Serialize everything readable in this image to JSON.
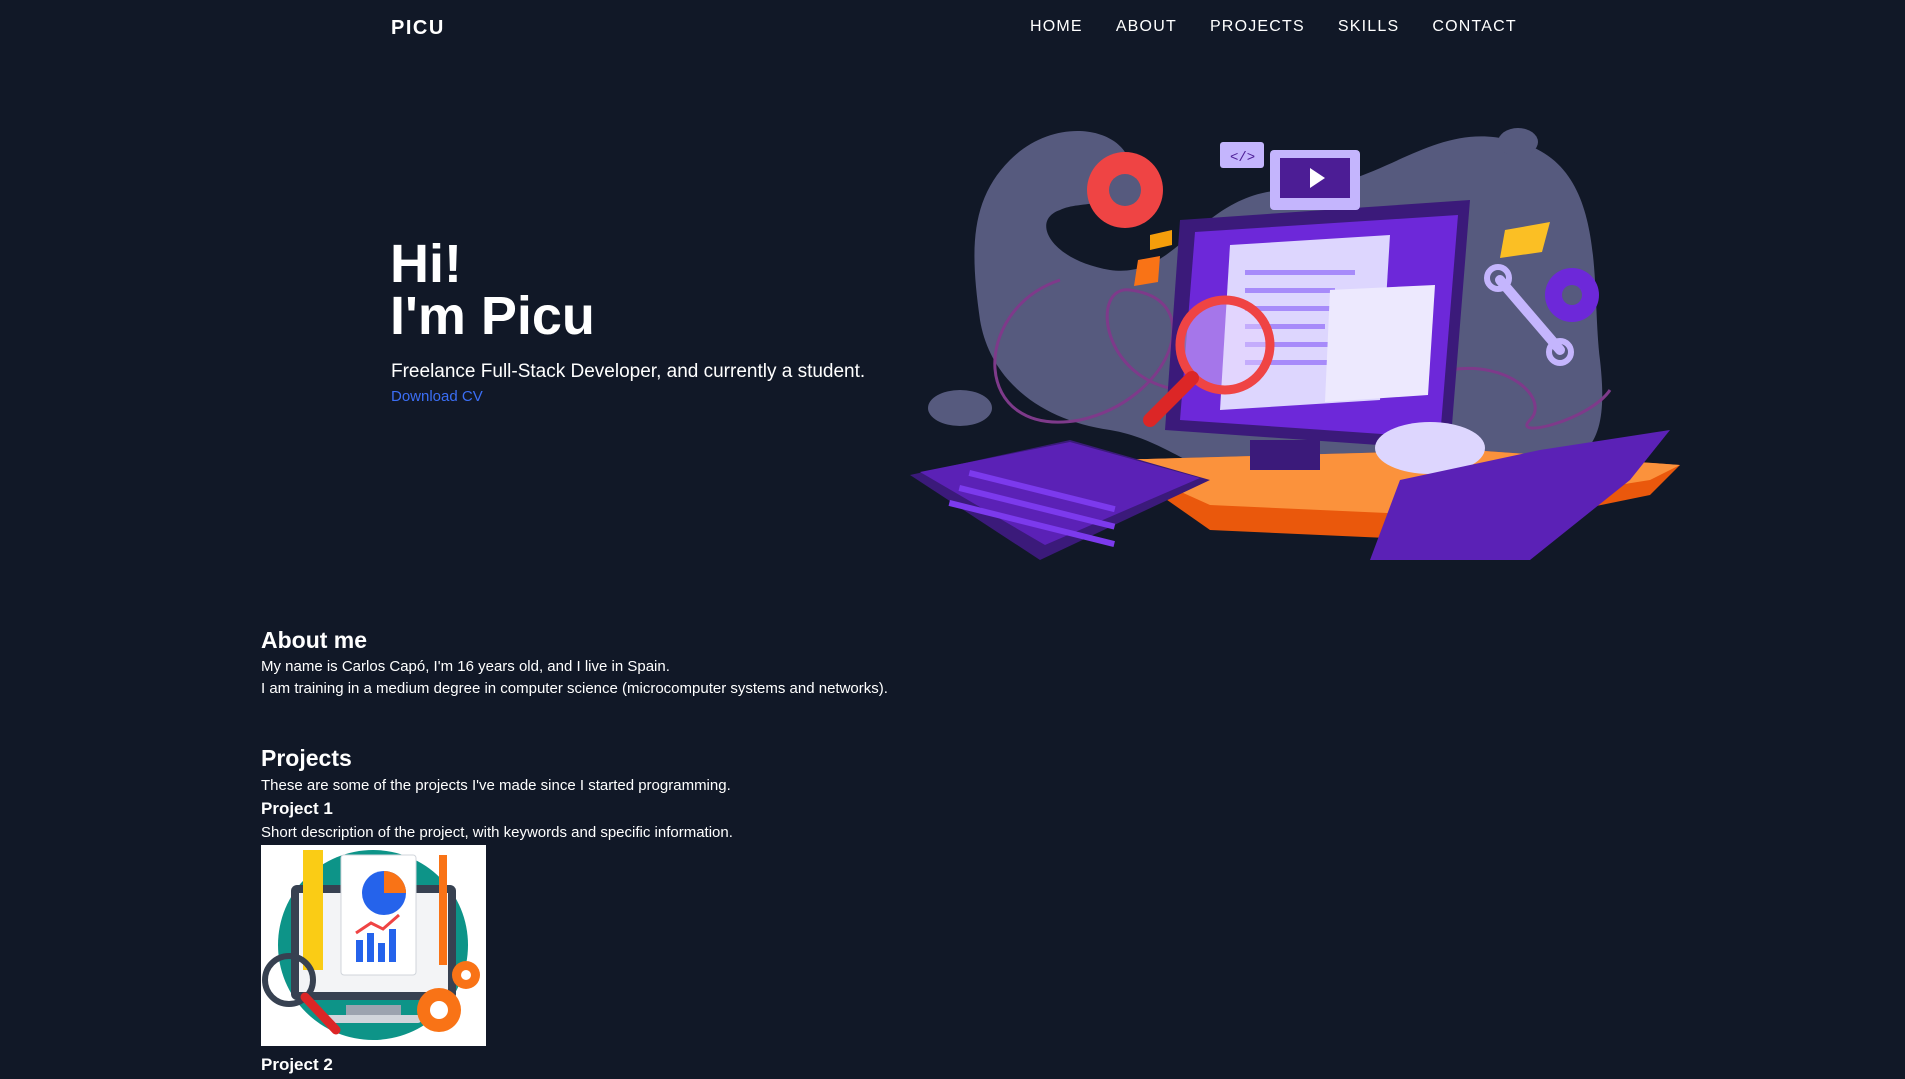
{
  "nav": {
    "logo": "PICU",
    "links": [
      "HOME",
      "ABOUT",
      "PROJECTS",
      "SKILLS",
      "CONTACT"
    ]
  },
  "hero": {
    "line1": "Hi!",
    "line2": "I'm Picu",
    "subtitle": "Freelance Full-Stack Developer, and currently a student.",
    "cv_link": "Download CV"
  },
  "about": {
    "title": "About me",
    "line1": "My name is Carlos Capó, I'm 16 years old, and I live in Spain.",
    "line2": "I am training in a medium degree in computer science (microcomputer systems and networks)."
  },
  "projects": {
    "title": "Projects",
    "intro": "These are some of the projects I've made since I started programming.",
    "items": [
      {
        "title": "Project 1",
        "description": "Short description of the project, with keywords and specific information.",
        "image_icon": "analytics-illustration"
      },
      {
        "title": "Project 2"
      }
    ]
  },
  "colors": {
    "background": "#111827",
    "link": "#3b6ef5",
    "blob": "#565a7e",
    "purple": "#5b21b6",
    "orange": "#f97316"
  }
}
